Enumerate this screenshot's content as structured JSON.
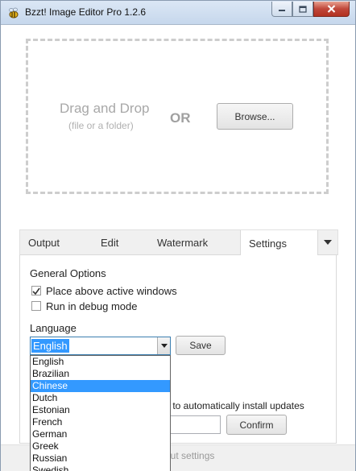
{
  "window": {
    "title": "Bzzt! Image Editor Pro 1.2.6"
  },
  "dropzone": {
    "title": "Drag and Drop",
    "subtitle": "(file or a folder)",
    "or": "OR",
    "browse_label": "Browse..."
  },
  "tabs": [
    {
      "label": "Output",
      "active": false
    },
    {
      "label": "Edit",
      "active": false
    },
    {
      "label": "Watermark",
      "active": false
    },
    {
      "label": "Settings",
      "active": true
    }
  ],
  "settings": {
    "general_title": "General Options",
    "options": [
      {
        "label": "Place above active windows",
        "checked": true
      },
      {
        "label": "Run in debug mode",
        "checked": false
      }
    ],
    "language_title": "Language",
    "language_value": "English",
    "save_label": "Save",
    "update_text": "s to automatically install updates",
    "confirm_label": "Confirm",
    "footer_text": "out settings"
  },
  "language_options": [
    "English",
    "Brazilian",
    "Chinese",
    "Dutch",
    "Estonian",
    "French",
    "German",
    "Greek",
    "Russian",
    "Swedish"
  ],
  "language_highlighted": "Chinese",
  "colors": {
    "selection": "#3399ff",
    "window_bg": "#ffffff",
    "chrome_bg": "#f0f0f0",
    "close_button": "#c0473a"
  },
  "icons": {
    "app": "bee-icon",
    "minimize": "minimize-icon",
    "maximize": "maximize-icon",
    "close": "close-icon",
    "tab_dropdown": "chevron-down-icon",
    "combo_dropdown": "chevron-down-icon",
    "checkmark": "checkmark-icon"
  }
}
